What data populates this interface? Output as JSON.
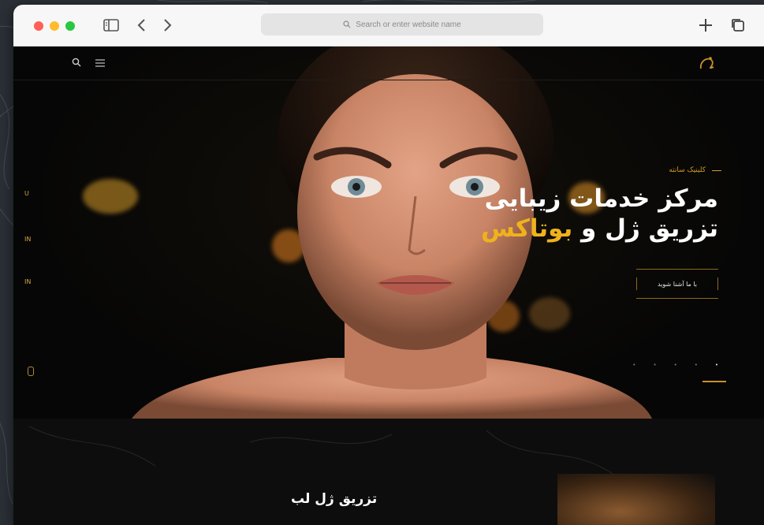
{
  "browser": {
    "address_placeholder": "Search or enter website name",
    "buttons": [
      "sidebar-toggle",
      "back",
      "forward",
      "new-tab",
      "tabs-overview"
    ]
  },
  "site": {
    "nav_icons": [
      "search-icon",
      "menu-icon"
    ],
    "hero": {
      "eyebrow": "کلینیک سانته",
      "headline_line1": "مرکز خدمات زیبایی",
      "headline_line2_prefix": "تزریق ژل و ",
      "headline_line2_highlight": "بوتاکس",
      "cta_label": "با ما آشنا شوید",
      "accent_color": "#f0b21c",
      "side_letters": [
        "U",
        "IN",
        "IN"
      ]
    },
    "section2": {
      "title": "تزریق ژل لب"
    }
  }
}
